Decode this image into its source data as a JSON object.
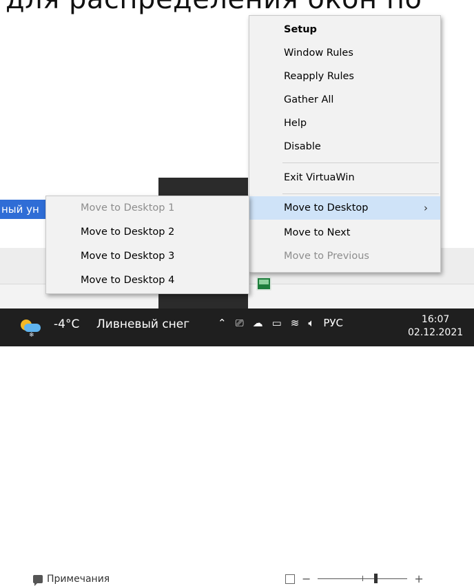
{
  "background": {
    "heading_fragment": "для распределения окон по",
    "selection_fragment": "ный ун",
    "notes_label": "Примечания",
    "zoom_minus": "−",
    "zoom_plus": "+"
  },
  "context_menu": {
    "items": [
      {
        "label": "Setup",
        "bold": true
      },
      {
        "label": "Window Rules"
      },
      {
        "label": "Reapply Rules"
      },
      {
        "label": "Gather All"
      },
      {
        "label": "Help"
      },
      {
        "label": "Disable"
      },
      {
        "label": "Exit VirtuaWin"
      },
      {
        "label": "Move to Desktop",
        "has_submenu": true,
        "highlighted": true
      },
      {
        "label": "Move to Next"
      },
      {
        "label": "Move to Previous",
        "disabled": true
      }
    ],
    "submenu_arrow": "›"
  },
  "submenu": {
    "items": [
      {
        "label": "Move to Desktop 1",
        "disabled": true
      },
      {
        "label": "Move to Desktop 2"
      },
      {
        "label": "Move to Desktop 3"
      },
      {
        "label": "Move to Desktop 4"
      }
    ]
  },
  "taskbar": {
    "temperature": "-4°C",
    "weather": "Ливневый снег",
    "language": "РУС",
    "time": "16:07",
    "date": "02.12.2021",
    "tray_icons": [
      "chevron-up-icon",
      "meet-icon",
      "cloud-icon",
      "battery-icon",
      "wifi-icon",
      "volume-icon"
    ]
  },
  "colors": {
    "menu_bg": "#f2f2f2",
    "menu_highlight": "#cfe3f8",
    "disabled_text": "#8d8d8d",
    "taskbar_bg": "#1f1f1f",
    "selection_blue": "#2f6dd6"
  }
}
